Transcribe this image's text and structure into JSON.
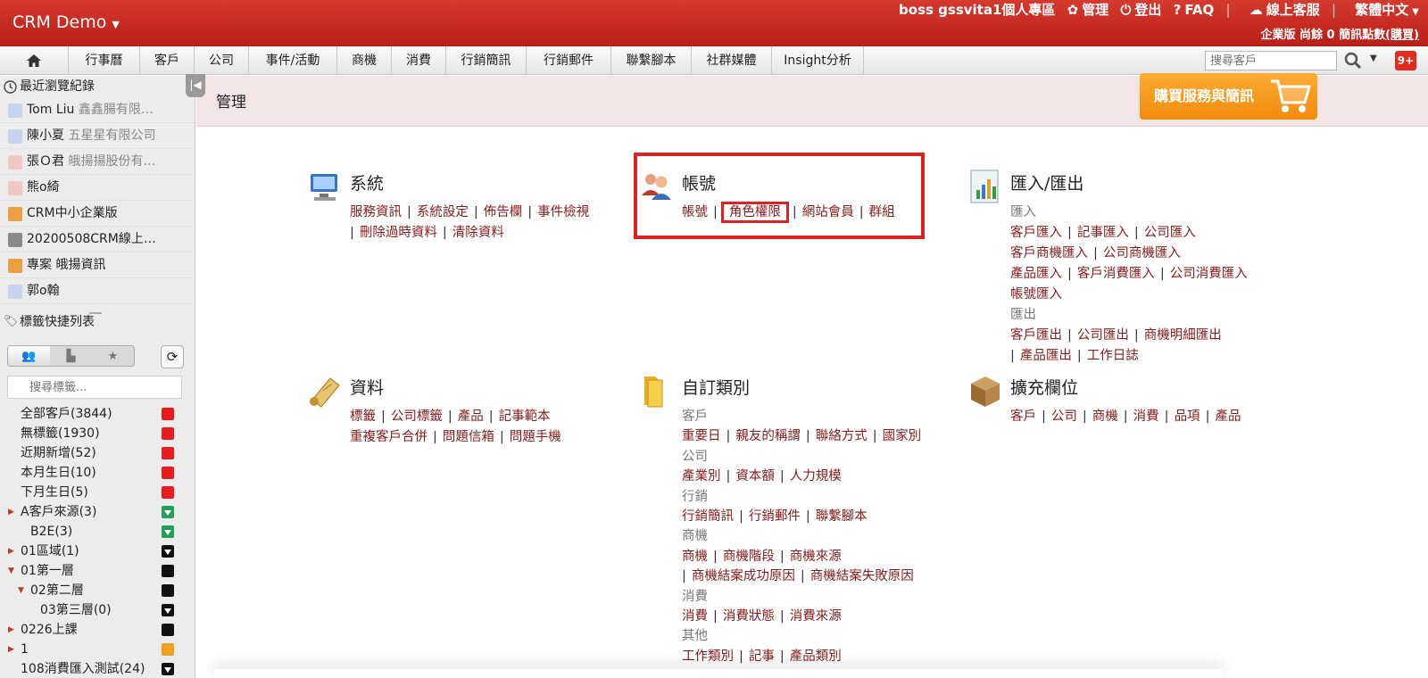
{
  "header": {
    "brand": "CRM Demo",
    "user": "boss gssvita1個人專區",
    "manage": "管理",
    "logout": "登出",
    "faq": "FAQ",
    "support": "線上客服",
    "language": "繁體中文",
    "plan_line": "企業版 尚餘 0 簡訊點數",
    "buy_link": "(購買)"
  },
  "menubar": {
    "tabs": [
      "行事曆",
      "客戶",
      "公司",
      "事件/活動",
      "商機",
      "消費",
      "行銷簡訊",
      "行銷郵件",
      "聯繫腳本",
      "社群媒體",
      "Insight分析"
    ],
    "search_placeholder": "搜尋客戶",
    "notif_count": "9+"
  },
  "sidebar": {
    "recent_title": "最近瀏覽紀錄",
    "recent": [
      {
        "name": "Tom Liu",
        "company": "鑫鑫腸有限…",
        "avatar_color": "#c8d4ea"
      },
      {
        "name": "陳小夏",
        "company": "五星星有限公司",
        "avatar_color": "#c8d4ea"
      },
      {
        "name": "張Ｏ君",
        "company": "皒揚揚股份有…",
        "avatar_color": "#f0c8c8"
      },
      {
        "name": "熊o綺",
        "company": "",
        "avatar_color": "#f0c8c8"
      },
      {
        "name": "CRM中小企業版",
        "company": "",
        "avatar_color": "#e8a040"
      },
      {
        "name": "20200508CRM線上…",
        "company": "",
        "avatar_color": "#8a8a8a"
      },
      {
        "name": "專案 皒揚資訊",
        "company": "",
        "avatar_color": "#e8a040"
      },
      {
        "name": "郭o翰",
        "company": "",
        "avatar_color": "#c8d4ea"
      }
    ],
    "tags_title": "標籤快捷列表",
    "tag_search_placeholder": "搜尋標籤...",
    "tags": [
      {
        "label": "全部客戶(3844)",
        "indent": 0,
        "arrow": "",
        "color": "#e81c1c"
      },
      {
        "label": "無標籤(1930)",
        "indent": 0,
        "arrow": "",
        "color": "#e81c1c"
      },
      {
        "label": "近期新增(52)",
        "indent": 0,
        "arrow": "",
        "color": "#e81c1c"
      },
      {
        "label": "本月生日(10)",
        "indent": 0,
        "arrow": "",
        "color": "#e81c1c"
      },
      {
        "label": "下月生日(5)",
        "indent": 0,
        "arrow": "",
        "color": "#e81c1c"
      },
      {
        "label": "A客戶來源(3)",
        "indent": 0,
        "arrow": "right",
        "color": "#22a05a",
        "filter": true
      },
      {
        "label": "B2E(3)",
        "indent": 1,
        "arrow": "",
        "color": "#22a05a",
        "filter": true
      },
      {
        "label": "01區域(1)",
        "indent": 0,
        "arrow": "right",
        "color": "#111",
        "filter": true
      },
      {
        "label": "01第一層",
        "indent": 0,
        "arrow": "down",
        "color": "#111"
      },
      {
        "label": "02第二層",
        "indent": 1,
        "arrow": "down",
        "color": "#111"
      },
      {
        "label": "03第三層(0)",
        "indent": 2,
        "arrow": "",
        "color": "#111",
        "filter": true
      },
      {
        "label": "0226上課",
        "indent": 0,
        "arrow": "right",
        "color": "#111"
      },
      {
        "label": "1",
        "indent": 0,
        "arrow": "right",
        "color": "#f0a020"
      },
      {
        "label": "108消費匯入測試(24)",
        "indent": 0,
        "arrow": "",
        "color": "#111",
        "filter": true
      }
    ]
  },
  "main": {
    "page_title": "管理",
    "buy_button": "購買服務與簡訊",
    "sections": {
      "system": {
        "title": "系統",
        "links_row1": [
          "服務資訊",
          "系統設定",
          "佈告欄",
          "事件檢視"
        ],
        "links_row2": [
          "刪除過時資料",
          "清除資料"
        ]
      },
      "account": {
        "title": "帳號",
        "links": [
          "帳號",
          "角色權限",
          "網站會員",
          "群組"
        ]
      },
      "io": {
        "title": "匯入/匯出",
        "import_label": "匯入",
        "import_rows": [
          [
            "客戶匯入",
            "記事匯入",
            "公司匯入"
          ],
          [
            "客戶商機匯入",
            "公司商機匯入"
          ],
          [
            "產品匯入",
            "客戶消費匯入",
            "公司消費匯入"
          ],
          [
            "帳號匯入"
          ]
        ],
        "export_label": "匯出",
        "export_rows": [
          [
            "客戶匯出",
            "公司匯出",
            "商機明細匯出"
          ],
          [
            "產品匯出",
            "工作日誌"
          ]
        ]
      },
      "data": {
        "title": "資料",
        "links_row1": [
          "標籤",
          "公司標籤",
          "產品",
          "記事範本"
        ],
        "links_row2": [
          "重複客戶合併",
          "問題信箱",
          "問題手機"
        ]
      },
      "custom": {
        "title": "自訂類別",
        "groups": [
          {
            "label": "客戶",
            "rows": [
              [
                "重要日",
                "親友的稱謂",
                "聯絡方式",
                "國家別"
              ]
            ]
          },
          {
            "label": "公司",
            "rows": [
              [
                "產業別",
                "資本額",
                "人力規模"
              ]
            ]
          },
          {
            "label": "行銷",
            "rows": [
              [
                "行銷簡訊",
                "行銷郵件",
                "聯繫腳本"
              ]
            ]
          },
          {
            "label": "商機",
            "rows": [
              [
                "商機",
                "商機階段",
                "商機來源"
              ],
              [
                "商機結案成功原因",
                "商機結案失敗原因"
              ]
            ]
          },
          {
            "label": "消費",
            "rows": [
              [
                "消費",
                "消費狀態",
                "消費來源"
              ]
            ]
          },
          {
            "label": "其他",
            "rows": [
              [
                "工作類別",
                "記事",
                "產品類別"
              ]
            ]
          }
        ]
      },
      "fields": {
        "title": "擴充欄位",
        "links": [
          "客戶",
          "公司",
          "商機",
          "消費",
          "品項",
          "產品"
        ]
      }
    }
  },
  "colors": {
    "header_red": "#c0281f",
    "link_red": "#8b1a1a",
    "highlight": "#e02020",
    "title_bg": "#f3e5e5",
    "buy_orange": "#f39c1a"
  }
}
